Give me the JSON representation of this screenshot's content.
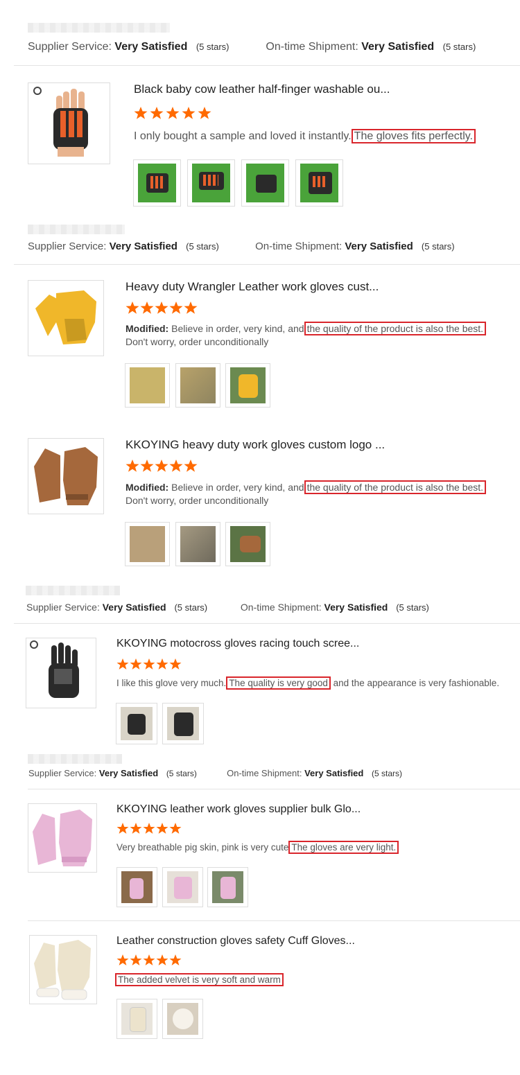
{
  "labels": {
    "supplier_service": "Supplier Service:",
    "on_time_shipment": "On-time Shipment:",
    "very_satisfied": "Very Satisfied",
    "five_stars": "(5 stars)",
    "modified": "Modified:"
  },
  "reviews": [
    {
      "title": "Black baby cow leather half-finger washable ou...",
      "rating": 5,
      "text_plain": "I only bought a sample and loved it instantly.",
      "text_highlight": "The gloves fits perfectly.",
      "text_after": ""
    },
    {
      "title": "Heavy duty Wrangler Leather work gloves cust...",
      "rating": 5,
      "text_plain": "Believe in order, very kind, and",
      "text_highlight": "the quality of the product is also the best.",
      "text_after": "Don't worry, order unconditionally"
    },
    {
      "title": "KKOYING heavy duty work gloves custom logo ...",
      "rating": 5,
      "text_plain": "Believe in order, very kind, and",
      "text_highlight": "the quality of the product is also the best.",
      "text_after": "Don't worry, order unconditionally"
    },
    {
      "title": "KKOYING motocross gloves racing touch scree...",
      "rating": 5,
      "text_plain": "I like this glove very much.",
      "text_highlight": "The quality is very good",
      "text_after": "and the appearance is very fashionable."
    },
    {
      "title": "KKOYING leather work gloves supplier bulk Glo...",
      "rating": 5,
      "text_plain": "Very breathable pig skin, pink is very cute",
      "text_highlight": "The gloves are very light.",
      "text_after": ""
    },
    {
      "title": "Leather construction gloves safety Cuff Gloves...",
      "rating": 5,
      "text_plain": "",
      "text_highlight": "The added velvet is very soft and warm",
      "text_after": ""
    }
  ],
  "colors": {
    "star": "#ff6a00",
    "highlight_border": "#d9252b",
    "glove_black": "#2a2a2a",
    "glove_orange": "#e8602a",
    "glove_yellow": "#f0b72a",
    "glove_brown": "#a5683c",
    "glove_pink": "#e8b6d6",
    "glove_cream": "#ece3cc",
    "grass": "#4aa33a"
  },
  "icons": [
    "star-icon",
    "brand-logo-icon"
  ]
}
